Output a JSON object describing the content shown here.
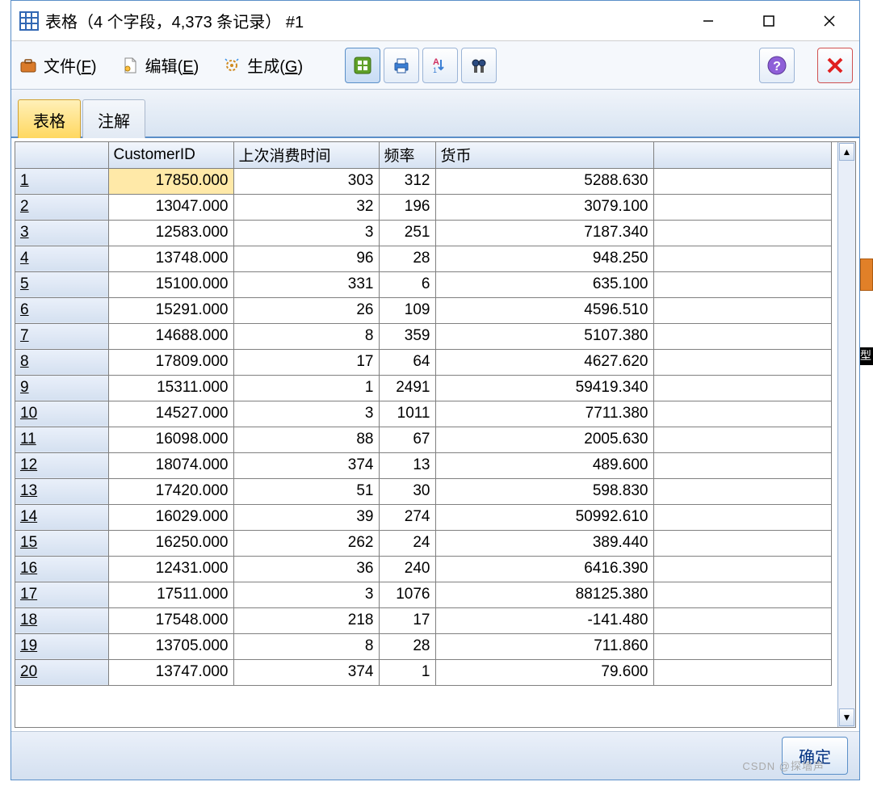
{
  "window": {
    "title": "表格（4 个字段，4,373 条记录） #1"
  },
  "menu": {
    "file": {
      "label": "文件",
      "accel": "F"
    },
    "edit": {
      "label": "编辑",
      "accel": "E"
    },
    "generate": {
      "label": "生成",
      "accel": "G"
    }
  },
  "tabs": {
    "table": "表格",
    "annotate": "注解"
  },
  "table": {
    "headers": {
      "row": "",
      "customer_id": "CustomerID",
      "last_purchase": "上次消费时间",
      "frequency": "频率",
      "currency": "货币"
    },
    "rows": [
      {
        "n": "1",
        "customer_id": "17850.000",
        "last_purchase": "303",
        "frequency": "312",
        "currency": "5288.630"
      },
      {
        "n": "2",
        "customer_id": "13047.000",
        "last_purchase": "32",
        "frequency": "196",
        "currency": "3079.100"
      },
      {
        "n": "3",
        "customer_id": "12583.000",
        "last_purchase": "3",
        "frequency": "251",
        "currency": "7187.340"
      },
      {
        "n": "4",
        "customer_id": "13748.000",
        "last_purchase": "96",
        "frequency": "28",
        "currency": "948.250"
      },
      {
        "n": "5",
        "customer_id": "15100.000",
        "last_purchase": "331",
        "frequency": "6",
        "currency": "635.100"
      },
      {
        "n": "6",
        "customer_id": "15291.000",
        "last_purchase": "26",
        "frequency": "109",
        "currency": "4596.510"
      },
      {
        "n": "7",
        "customer_id": "14688.000",
        "last_purchase": "8",
        "frequency": "359",
        "currency": "5107.380"
      },
      {
        "n": "8",
        "customer_id": "17809.000",
        "last_purchase": "17",
        "frequency": "64",
        "currency": "4627.620"
      },
      {
        "n": "9",
        "customer_id": "15311.000",
        "last_purchase": "1",
        "frequency": "2491",
        "currency": "59419.340"
      },
      {
        "n": "10",
        "customer_id": "14527.000",
        "last_purchase": "3",
        "frequency": "1011",
        "currency": "7711.380"
      },
      {
        "n": "11",
        "customer_id": "16098.000",
        "last_purchase": "88",
        "frequency": "67",
        "currency": "2005.630"
      },
      {
        "n": "12",
        "customer_id": "18074.000",
        "last_purchase": "374",
        "frequency": "13",
        "currency": "489.600"
      },
      {
        "n": "13",
        "customer_id": "17420.000",
        "last_purchase": "51",
        "frequency": "30",
        "currency": "598.830"
      },
      {
        "n": "14",
        "customer_id": "16029.000",
        "last_purchase": "39",
        "frequency": "274",
        "currency": "50992.610"
      },
      {
        "n": "15",
        "customer_id": "16250.000",
        "last_purchase": "262",
        "frequency": "24",
        "currency": "389.440"
      },
      {
        "n": "16",
        "customer_id": "12431.000",
        "last_purchase": "36",
        "frequency": "240",
        "currency": "6416.390"
      },
      {
        "n": "17",
        "customer_id": "17511.000",
        "last_purchase": "3",
        "frequency": "1076",
        "currency": "88125.380"
      },
      {
        "n": "18",
        "customer_id": "17548.000",
        "last_purchase": "218",
        "frequency": "17",
        "currency": "-141.480"
      },
      {
        "n": "19",
        "customer_id": "13705.000",
        "last_purchase": "8",
        "frequency": "28",
        "currency": "711.860"
      },
      {
        "n": "20",
        "customer_id": "13747.000",
        "last_purchase": "374",
        "frequency": "1",
        "currency": "79.600"
      }
    ]
  },
  "footer": {
    "ok": "确定"
  },
  "watermark": "CSDN @探墙声",
  "sliver_b_text": "型"
}
